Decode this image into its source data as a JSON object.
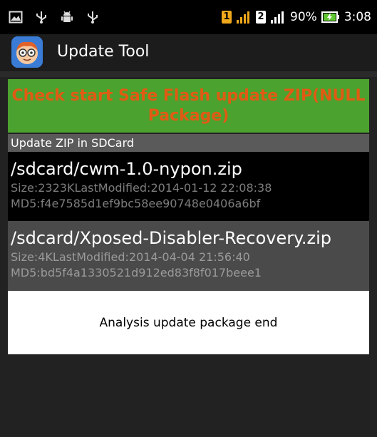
{
  "status_bar": {
    "left_icons": [
      "image-icon",
      "usb-icon",
      "android-icon",
      "usb-icon"
    ],
    "sim1_label": "1",
    "sim2_label": "2",
    "battery_percent_text": "90%",
    "time": "3:08",
    "colors": {
      "sim1": "#f0a81b",
      "signal": "#f0a81b"
    }
  },
  "action_bar": {
    "app_icon": "app-face-icon",
    "title": "Update Tool"
  },
  "check_button": {
    "label": "Check start Safe Flash update ZIP(NULL Package)",
    "colors": {
      "background": "#4ca22f",
      "text": "#e15a13"
    }
  },
  "section": {
    "header": "Update ZIP in SDCard"
  },
  "zip_list": [
    {
      "path": "/sdcard/cwm-1.0-nypon.zip",
      "size_line": "Size:2323KLastModified:2014-01-12 22:08:38",
      "md5_line": "MD5:f4e7585d1ef9bc58ee90748e0406a6bf"
    },
    {
      "path": "/sdcard/Xposed-Disabler-Recovery.zip",
      "size_line": "Size:4KLastModified:2014-04-04 21:56:40",
      "md5_line": "MD5:bd5f4a1330521d912ed83f8f017beee1"
    }
  ],
  "result": {
    "message": "Analysis update package end"
  }
}
